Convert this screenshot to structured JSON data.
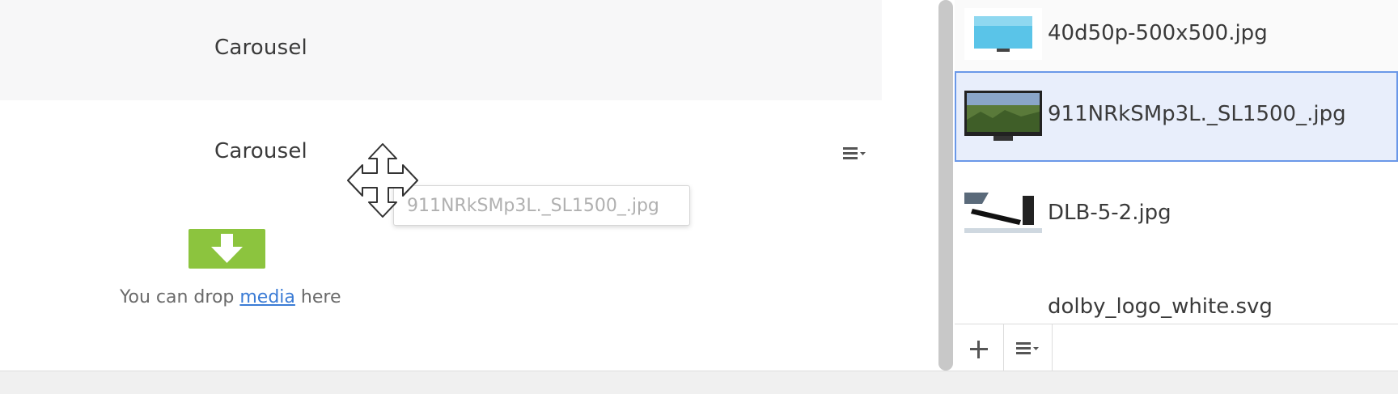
{
  "content": {
    "rows": [
      {
        "label": "Carousel"
      },
      {
        "label": "Carousel"
      }
    ],
    "dropzone": {
      "text_before": "You can drop ",
      "link": "media",
      "text_after": " here"
    }
  },
  "drag_ghost": {
    "filename": "911NRkSMp3L._SL1500_.jpg"
  },
  "media_panel": {
    "items": [
      {
        "name": "40d50p-500x500.jpg",
        "thumb": "tv-blue-thumbnail"
      },
      {
        "name": "911NRkSMp3L._SL1500_.jpg",
        "thumb": "tv-landscape-thumbnail",
        "selected": true
      },
      {
        "name": "DLB-5-2.jpg",
        "thumb": "soundbar-thumbnail"
      },
      {
        "name": "dolby_logo_white.svg",
        "thumb": "none"
      }
    ],
    "toolbar": {
      "add_icon": "plus-icon",
      "menu_icon": "menu-icon"
    }
  },
  "colors": {
    "accent_green": "#8cc43e",
    "selection_blue": "#6a98e8",
    "link_blue": "#3a7bd5"
  }
}
